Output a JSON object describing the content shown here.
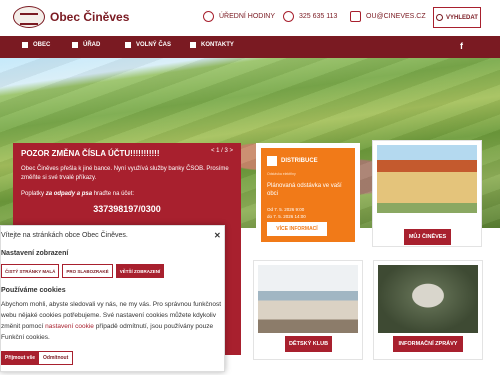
{
  "header": {
    "site_title": "Obec Činěves",
    "office_hours": "ÚŘEDNÍ HODINY",
    "phone": "325 635 113",
    "email": "OU@CINEVES.CZ",
    "search_label": "VYHLEDAT"
  },
  "nav": {
    "items": [
      {
        "label": "OBEC",
        "icon": "home-icon"
      },
      {
        "label": "ÚŘAD",
        "icon": "building-icon"
      },
      {
        "label": "VOLNÝ ČAS",
        "icon": "leisure-icon"
      },
      {
        "label": "KONTAKTY",
        "icon": "phone-icon"
      }
    ],
    "social": "f"
  },
  "alert": {
    "title": "POZOR ZMĚNA ČÍSLA ÚČTU!!!!!!!!!!!",
    "pager": "< 1 / 3 >",
    "text": "Obec Činěves přešla k jiné bance. Nyní využívá služby banky ČSOB. Prosíme změňte si své trvalé příkazy.",
    "note_prefix": "Poplatky",
    "note_bold": "za odpady a psa",
    "note_suffix": "hraďte na účet:",
    "account": "337398197/0300"
  },
  "cookie": {
    "welcome": "Vítejte na stránkách obce Obec Činěves.",
    "settings_heading": "Nastavení zobrazení",
    "btn_dark": "ČISTÝ STRÁNKY MALÁ",
    "btn_contrast": "PRO SLABOZRAKÉ",
    "btn_zoom": "VĚTŠÍ ZOBRAZENÍ",
    "cookies_heading": "Používáme cookies",
    "body_a": "Abychom mohli, abyste sledovali vy nás, ne my vás. Pro správnou funkčnost webu nějaké cookies potřebujeme. Své nastavení cookies můžete kdykoliv změnit pomocí",
    "link": "nastavení cookie",
    "body_b": "případě odmítnutí, jsou používány pouze Funkční cookies.",
    "accept": "Přijmout vše",
    "decline": "Odmítnout"
  },
  "cards": {
    "distribuce": {
      "brand": "DISTRIBUCE",
      "sub": "Odstávka elektřiny",
      "title": "Plánovaná odstávka ve vaší obci",
      "dates": [
        "Od 7. 5. 2026 9:00",
        "do 7. 5. 2026 14:00"
      ],
      "more": "VÍCE INFORMACÍ"
    },
    "moje": {
      "label": "MŮJ ČINĚVES"
    },
    "klub": {
      "label": "DĚTSKÝ KLUB"
    },
    "zpravy": {
      "label": "INFORMAČNÍ ZPRÁVY"
    }
  }
}
